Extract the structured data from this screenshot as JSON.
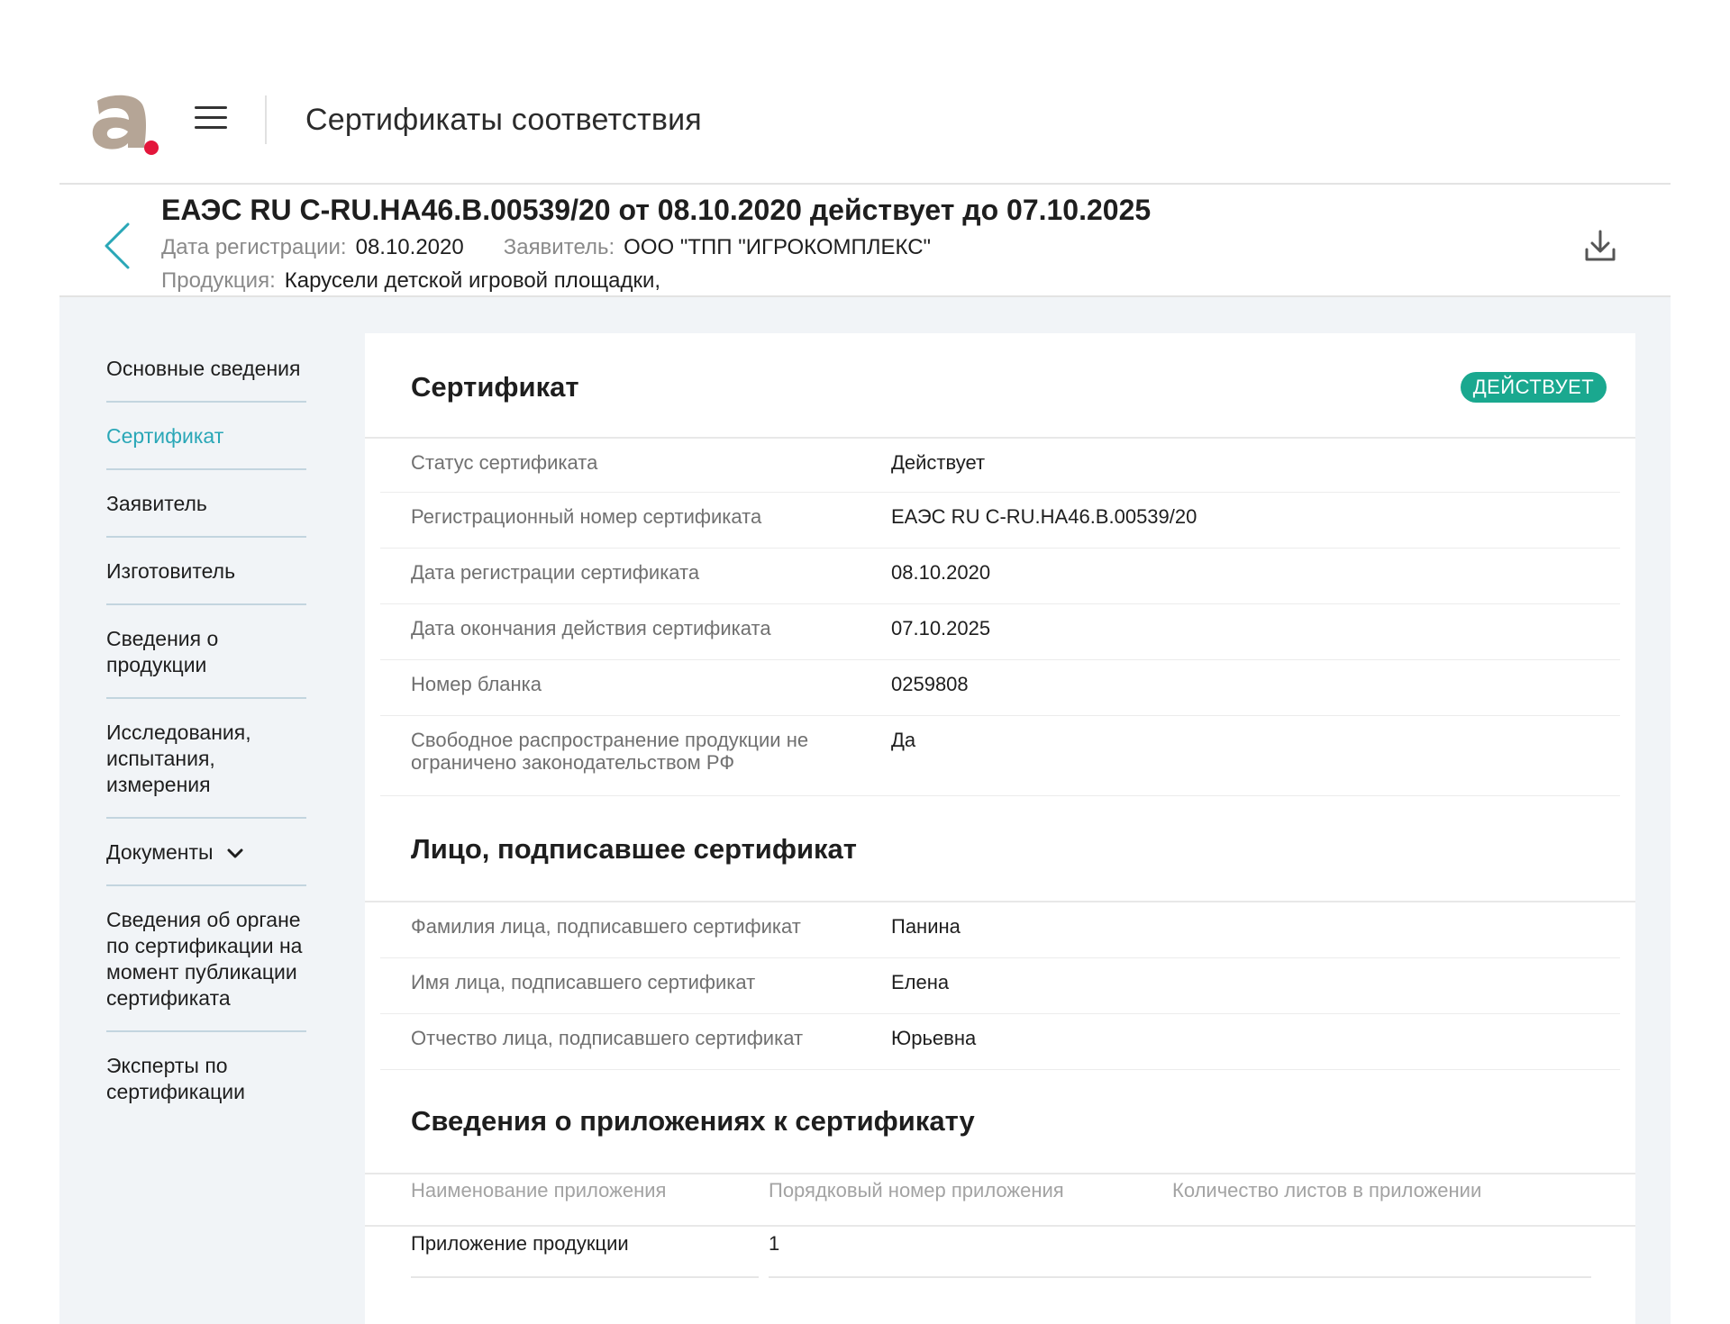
{
  "app": {
    "title": "Сертификаты соответствия",
    "logo_icon": "brand-logo-a",
    "accent_color": "#2aa7b7",
    "status_color": "#1aa88f"
  },
  "certificate": {
    "title": "ЕАЭС RU C-RU.НА46.В.00539/20 от 08.10.2020 действует до 07.10.2025",
    "reg_date_label": "Дата регистрации:",
    "reg_date_value": "08.10.2020",
    "applicant_label": "Заявитель:",
    "applicant_value": "ООО \"ТПП \"ИГРОКОМПЛЕКС\"",
    "product_label": "Продукция:",
    "product_value": "Карусели детской игровой площадки,"
  },
  "sidebar": {
    "items": [
      {
        "label": "Основные сведения"
      },
      {
        "label": "Сертификат",
        "active": true
      },
      {
        "label": "Заявитель"
      },
      {
        "label": "Изготовитель"
      },
      {
        "label": "Сведения о продукции"
      },
      {
        "label": "Исследования, испытания, измерения"
      },
      {
        "label": "Документы"
      },
      {
        "label": "Сведения об органе по сертификации на момент публикации сертификата"
      },
      {
        "label": "Эксперты по сертификации"
      }
    ]
  },
  "content": {
    "certificate_section": {
      "title": "Сертификат",
      "badge": "ДЕЙСТВУЕТ",
      "rows": [
        {
          "key": "Статус сертификата",
          "value": "Действует"
        },
        {
          "key": "Регистрационный номер сертификата",
          "value": "ЕАЭС RU C-RU.НА46.В.00539/20"
        },
        {
          "key": "Дата регистрации сертификата",
          "value": "08.10.2020"
        },
        {
          "key": "Дата окончания действия сертификата",
          "value": "07.10.2025"
        },
        {
          "key": "Номер бланка",
          "value": "0259808"
        },
        {
          "key": "Свободное распространение продукции не ограничено законодательством РФ",
          "value": "Да"
        }
      ]
    },
    "signer_section": {
      "title": "Лицо, подписавшее сертификат",
      "rows": [
        {
          "key": "Фамилия лица, подписавшего сертификат",
          "value": "Панина"
        },
        {
          "key": "Имя лица, подписавшего сертификат",
          "value": "Елена"
        },
        {
          "key": "Отчество лица, подписавшего сертификат",
          "value": "Юрьевна"
        }
      ]
    },
    "attachments_section": {
      "title": "Сведения о приложениях к сертификату",
      "columns": [
        "Наименование приложения",
        "Порядковый номер приложения",
        "Количество листов в приложении"
      ],
      "rows": [
        [
          "Приложение продукции",
          "1",
          ""
        ]
      ]
    }
  }
}
